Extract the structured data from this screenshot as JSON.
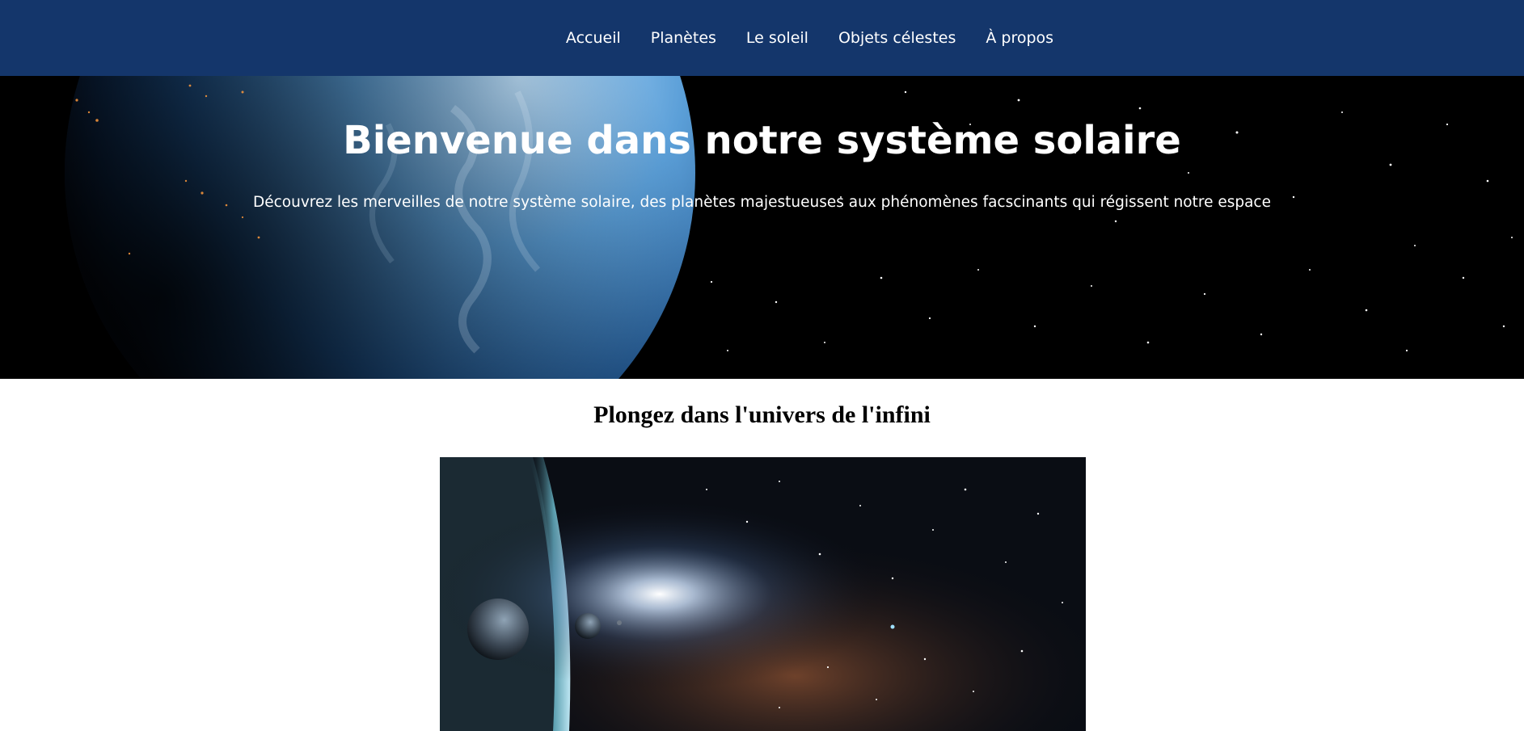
{
  "nav": {
    "items": [
      {
        "label": "Accueil"
      },
      {
        "label": "Planètes"
      },
      {
        "label": "Le soleil"
      },
      {
        "label": "Objets célestes"
      },
      {
        "label": "À propos"
      }
    ]
  },
  "hero": {
    "title": "Bienvenue dans notre système solaire",
    "subtitle": "Découvrez les merveilles de notre système solaire, des planètes majestueuses aux phénomènes facscinants qui régissent notre espace"
  },
  "section": {
    "title": "Plongez dans l'univers de l'infini"
  },
  "colors": {
    "navbar": "#14366b",
    "hero_background": "#000000",
    "text_light": "#ffffff"
  }
}
